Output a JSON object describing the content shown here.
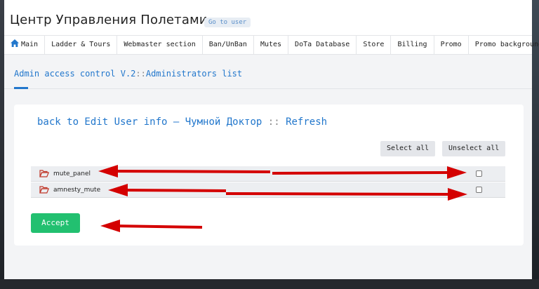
{
  "header": {
    "title": "Центр Управления Полетами",
    "go_user": "Go to user"
  },
  "nav": {
    "items": [
      {
        "label": "Main",
        "icon": "home-icon"
      },
      {
        "label": "Ladder & Tours"
      },
      {
        "label": "Webmaster section"
      },
      {
        "label": "Ban/UnBan"
      },
      {
        "label": "Mutes"
      },
      {
        "label": "DoTa Database"
      },
      {
        "label": "Store"
      },
      {
        "label": "Billing"
      },
      {
        "label": "Promo"
      },
      {
        "label": "Promo background"
      }
    ]
  },
  "page": {
    "heading_part1": "Admin access control V.2",
    "heading_sep": "::",
    "heading_part2": "Administrators list"
  },
  "card": {
    "back_link": "back to Edit User info",
    "dash": "–",
    "user_name": "Чумной Доктор",
    "sep": "::",
    "refresh": "Refresh",
    "select_all": "Select all",
    "unselect_all": "Unselect all",
    "permissions": [
      {
        "name": "mute_panel",
        "checked": false
      },
      {
        "name": "amnesty_mute",
        "checked": false
      }
    ],
    "accept": "Accept"
  },
  "colors": {
    "accent": "#2277cc",
    "accept": "#22c070",
    "annotation_arrow": "#d40000",
    "folder": "#c0392b"
  }
}
